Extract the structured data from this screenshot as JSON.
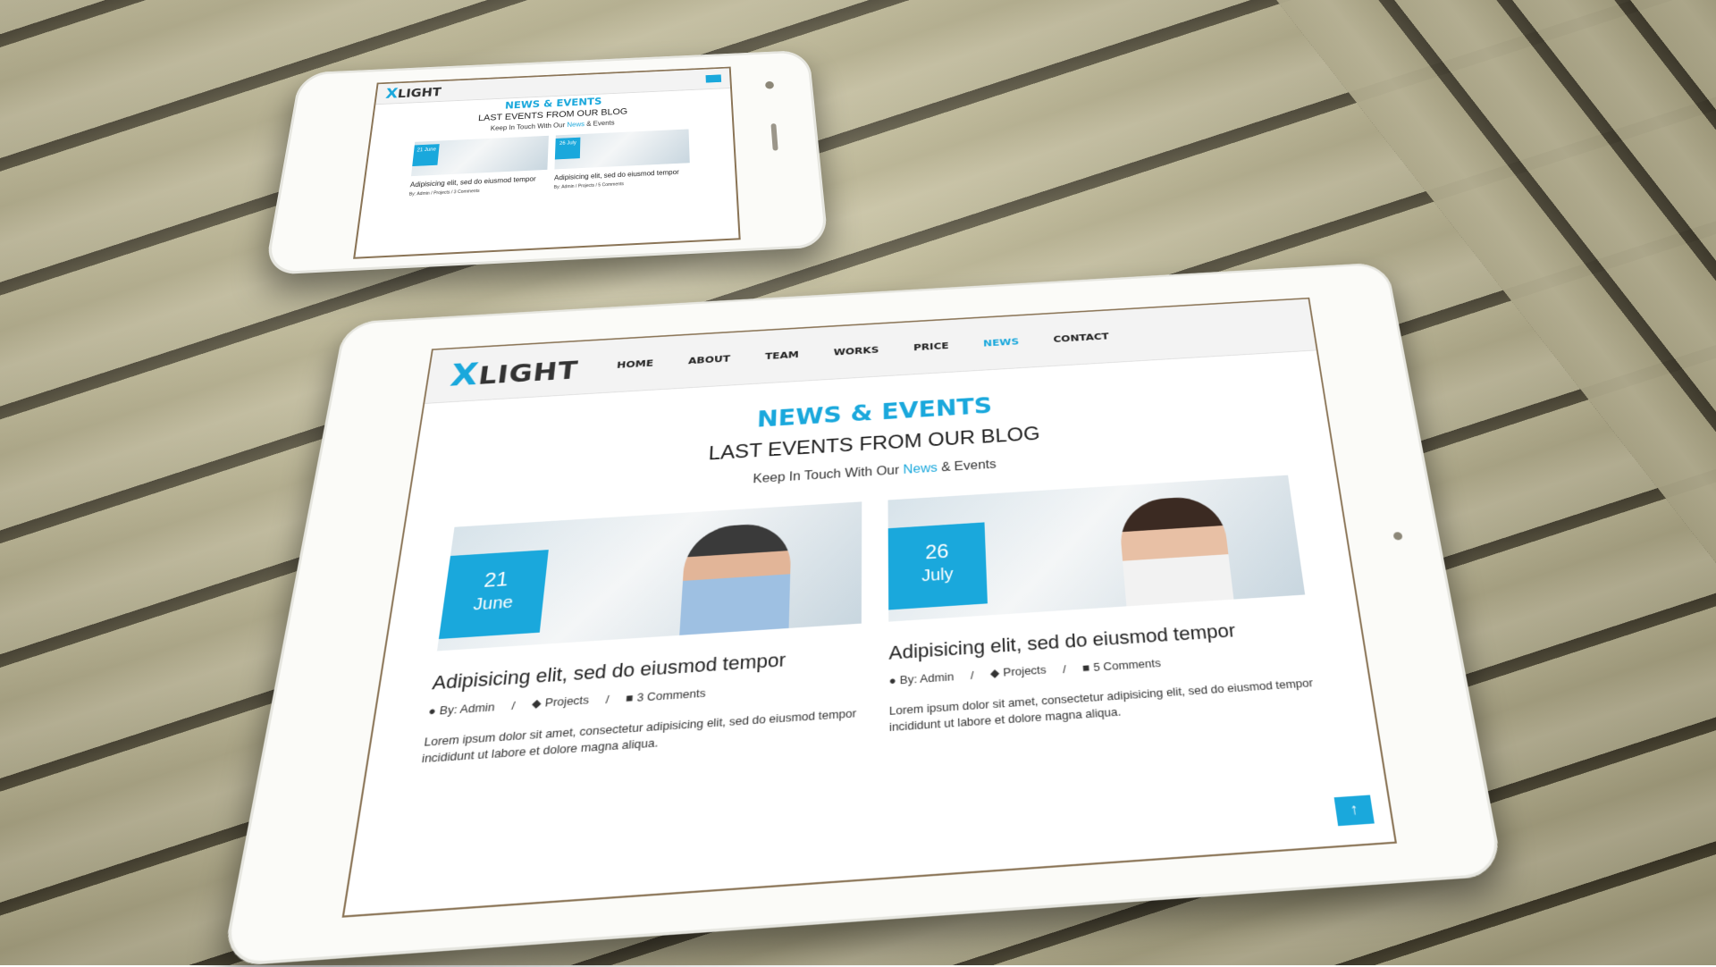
{
  "site": {
    "logo": {
      "x": "X",
      "rest": "LIGHT"
    },
    "nav": [
      "HOME",
      "ABOUT",
      "TEAM",
      "WORKS",
      "PRICE",
      "NEWS",
      "CONTACT"
    ],
    "active_nav": "NEWS",
    "section_title": "NEWS & EVENTS",
    "section_subtitle": "LAST EVENTS FROM OUR BLOG",
    "tagline": {
      "before": "Keep In Touch With Our ",
      "highlight": "News",
      "after": " & Events"
    },
    "posts": [
      {
        "day": "21",
        "month": "June",
        "title": "Adipisicing elit, sed do eiusmod tempor",
        "author": "By: Admin",
        "category": "Projects",
        "comments": "3 Comments",
        "excerpt": "Lorem ipsum dolor sit amet, consectetur adipisicing elit, sed do eiusmod tempor incididunt ut labore et dolore magna aliqua."
      },
      {
        "day": "26",
        "month": "July",
        "title": "Adipisicing elit, sed do eiusmod tempor",
        "author": "By: Admin",
        "category": "Projects",
        "comments": "5 Comments",
        "excerpt": "Lorem ipsum dolor sit amet, consectetur adipisicing elit, sed do eiusmod tempor incididunt ut labore et dolore magna aliqua."
      }
    ],
    "separator": "/",
    "scroll_top_icon": "arrow-up-icon"
  },
  "colors": {
    "accent": "#1aa8dc",
    "text": "#222222"
  }
}
